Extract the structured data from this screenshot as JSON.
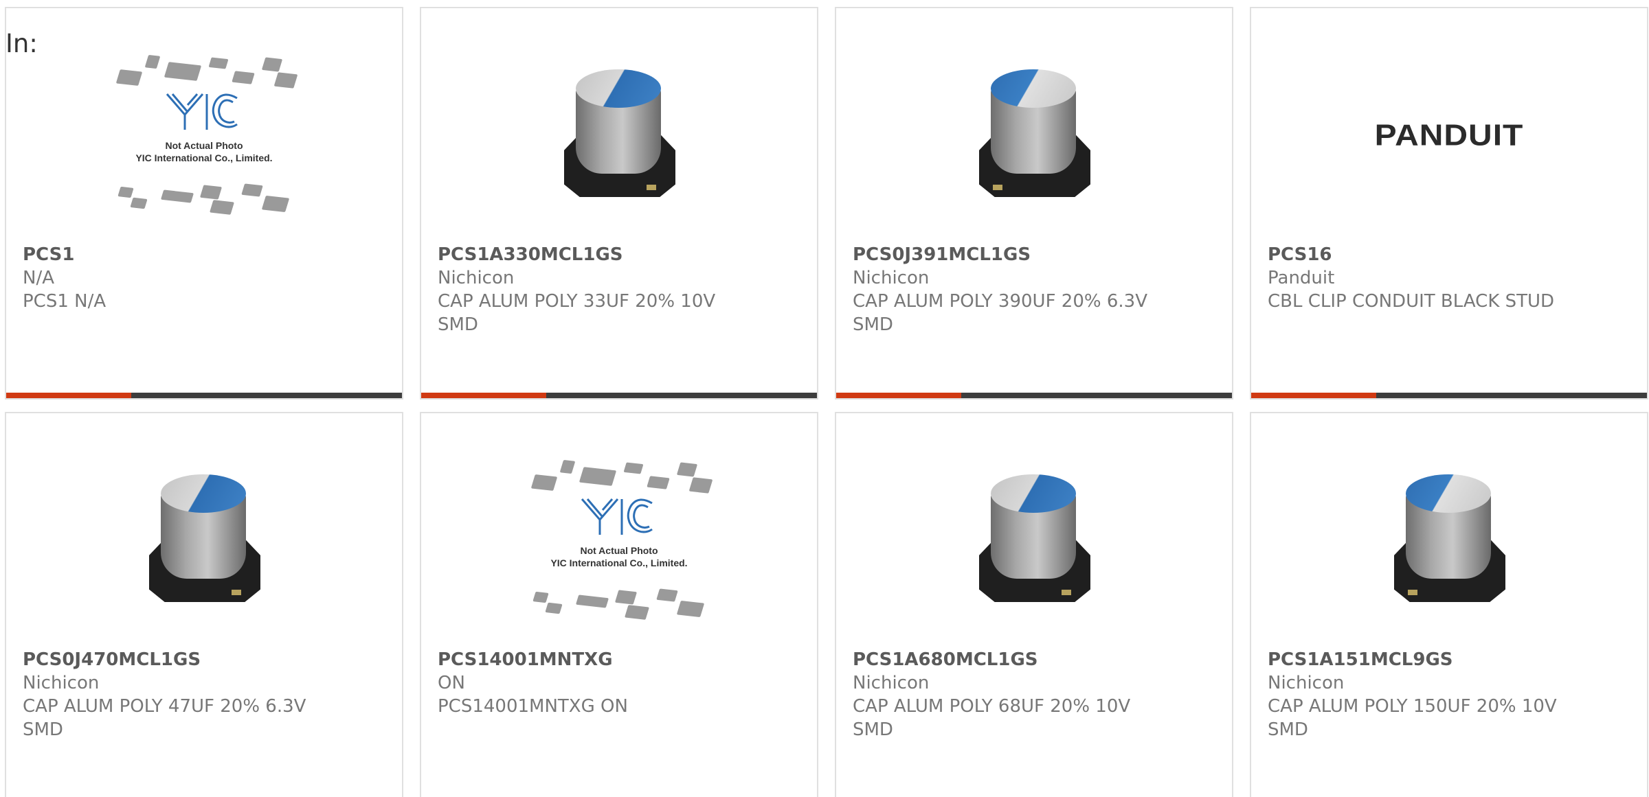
{
  "filter": {
    "label": "In:"
  },
  "products": [
    {
      "part_number": "PCS1",
      "manufacturer": "N/A",
      "description": "PCS1 N/A",
      "image": "placeholder-yic",
      "placeholder_text": [
        "Not Actual Photo",
        "YIC International Co., Limited."
      ]
    },
    {
      "part_number": "PCS1A330MCL1GS",
      "manufacturer": "Nichicon",
      "description": "CAP ALUM POLY 33UF 20% 10V SMD",
      "image": "capacitor"
    },
    {
      "part_number": "PCS0J391MCL1GS",
      "manufacturer": "Nichicon",
      "description": "CAP ALUM POLY 390UF 20% 6.3V SMD",
      "image": "capacitor"
    },
    {
      "part_number": "PCS16",
      "manufacturer": "Panduit",
      "description": "CBL CLIP CONDUIT BLACK STUD",
      "image": "panduit-logo",
      "logo_text": "PANDUIT"
    },
    {
      "part_number": "PCS0J470MCL1GS",
      "manufacturer": "Nichicon",
      "description": "CAP ALUM POLY 47UF 20% 6.3V SMD",
      "image": "capacitor"
    },
    {
      "part_number": "PCS14001MNTXG",
      "manufacturer": "ON",
      "description": "PCS14001MNTXG ON",
      "image": "placeholder-yic",
      "placeholder_text": [
        "Not Actual Photo",
        "YIC International Co., Limited."
      ]
    },
    {
      "part_number": "PCS1A680MCL1GS",
      "manufacturer": "Nichicon",
      "description": "CAP ALUM POLY 68UF 20% 10V SMD",
      "image": "capacitor"
    },
    {
      "part_number": "PCS1A151MCL9GS",
      "manufacturer": "Nichicon",
      "description": "CAP ALUM POLY 150UF 20% 10V SMD",
      "image": "capacitor"
    }
  ],
  "colors": {
    "accent_bar": "#d03a13",
    "bar_dark": "#3d3d3d",
    "card_border": "#e0e0e0",
    "capacitor_blue": "#2e6fb4"
  }
}
